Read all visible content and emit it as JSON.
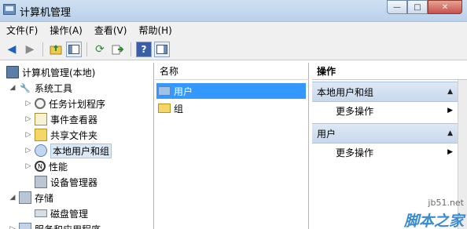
{
  "window": {
    "title": "计算机管理",
    "minimize_glyph": "—",
    "maximize_glyph": "□",
    "close_glyph": "✕"
  },
  "menu": {
    "items": [
      "文件(F)",
      "操作(A)",
      "查看(V)",
      "帮助(H)"
    ]
  },
  "toolbar": {
    "buttons": [
      "back-icon",
      "forward-icon",
      "up-folder-icon",
      "show-hide-tree-icon",
      "refresh-icon",
      "export-icon",
      "help-icon",
      "show-hide-action-pane-icon"
    ]
  },
  "tree": {
    "root": "计算机管理(本地)",
    "system_tools": "系统工具",
    "task_scheduler": "任务计划程序",
    "event_viewer": "事件查看器",
    "shared_folders": "共享文件夹",
    "local_users_groups": "本地用户和组",
    "performance": "性能",
    "device_manager": "设备管理器",
    "storage": "存储",
    "disk_management": "磁盘管理",
    "services_apps": "服务和应用程序"
  },
  "list": {
    "column_name": "名称",
    "rows": [
      "用户",
      "组"
    ]
  },
  "actions": {
    "header": "操作",
    "groups": [
      {
        "title": "本地用户和组",
        "item": "更多操作"
      },
      {
        "title": "用户",
        "item": "更多操作"
      }
    ]
  },
  "watermark": {
    "url": "jb51.net",
    "text": "脚本之家"
  }
}
